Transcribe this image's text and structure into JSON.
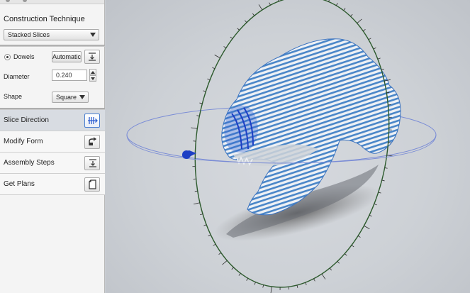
{
  "panel": {
    "construction": {
      "title": "Construction Technique",
      "technique": "Stacked Slices"
    },
    "dowels": {
      "label": "Dowels",
      "mode_button": "Automatic",
      "diameter_label": "Diameter",
      "diameter_value": "0.240",
      "shape_label": "Shape",
      "shape_value": "Square"
    },
    "steps": [
      {
        "label": "Slice Direction",
        "icon": "slice-direction-icon",
        "active": true
      },
      {
        "label": "Modify Form",
        "icon": "modify-form-icon",
        "active": false
      },
      {
        "label": "Assembly Steps",
        "icon": "assembly-steps-icon",
        "active": false
      },
      {
        "label": "Get Plans",
        "icon": "get-plans-icon",
        "active": false
      }
    ]
  },
  "colors": {
    "accent": "#2f5fd0",
    "model_slice": "#4a86c8",
    "ring_vertical": "#2c5a2c",
    "ring_horizontal": "#7a8cd6"
  }
}
